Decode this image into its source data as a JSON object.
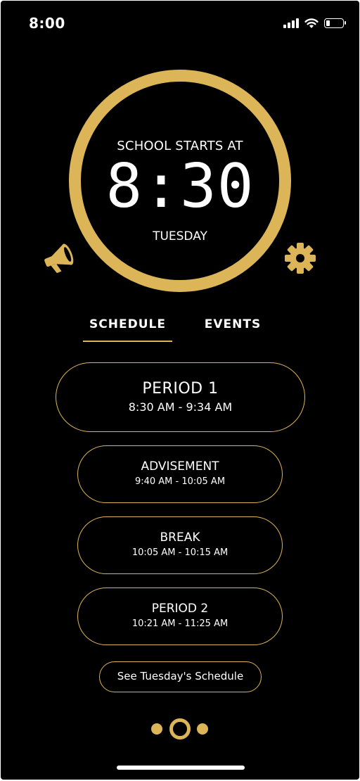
{
  "status_bar": {
    "time": "8:00",
    "signal_icon": "cellular-signal-icon",
    "wifi_icon": "wifi-icon",
    "battery_icon": "battery-icon",
    "battery_level": 0.25
  },
  "clock": {
    "caption": "SCHOOL STARTS AT",
    "time": "8:30",
    "day": "TUESDAY",
    "ring_color": "#dcb558"
  },
  "actions": {
    "announcements_icon": "megaphone-icon",
    "settings_icon": "gear-icon"
  },
  "tabs": [
    {
      "label": "SCHEDULE",
      "active": true
    },
    {
      "label": "EVENTS",
      "active": false
    }
  ],
  "schedule": [
    {
      "name": "PERIOD 1",
      "time": "8:30 AM - 9:34 AM",
      "current": true
    },
    {
      "name": "ADVISEMENT",
      "time": "9:40 AM - 10:05 AM",
      "current": false
    },
    {
      "name": "BREAK",
      "time": "10:05 AM - 10:15 AM",
      "current": false
    },
    {
      "name": "PERIOD 2",
      "time": "10:21 AM - 11:25 AM",
      "current": false
    }
  ],
  "see_schedule_button": "See Tuesday's Schedule",
  "pagination": {
    "total_pages": 3,
    "current_page": 2
  },
  "colors": {
    "accent": "#dcb558",
    "background": "#000000",
    "text": "#ffffff"
  }
}
